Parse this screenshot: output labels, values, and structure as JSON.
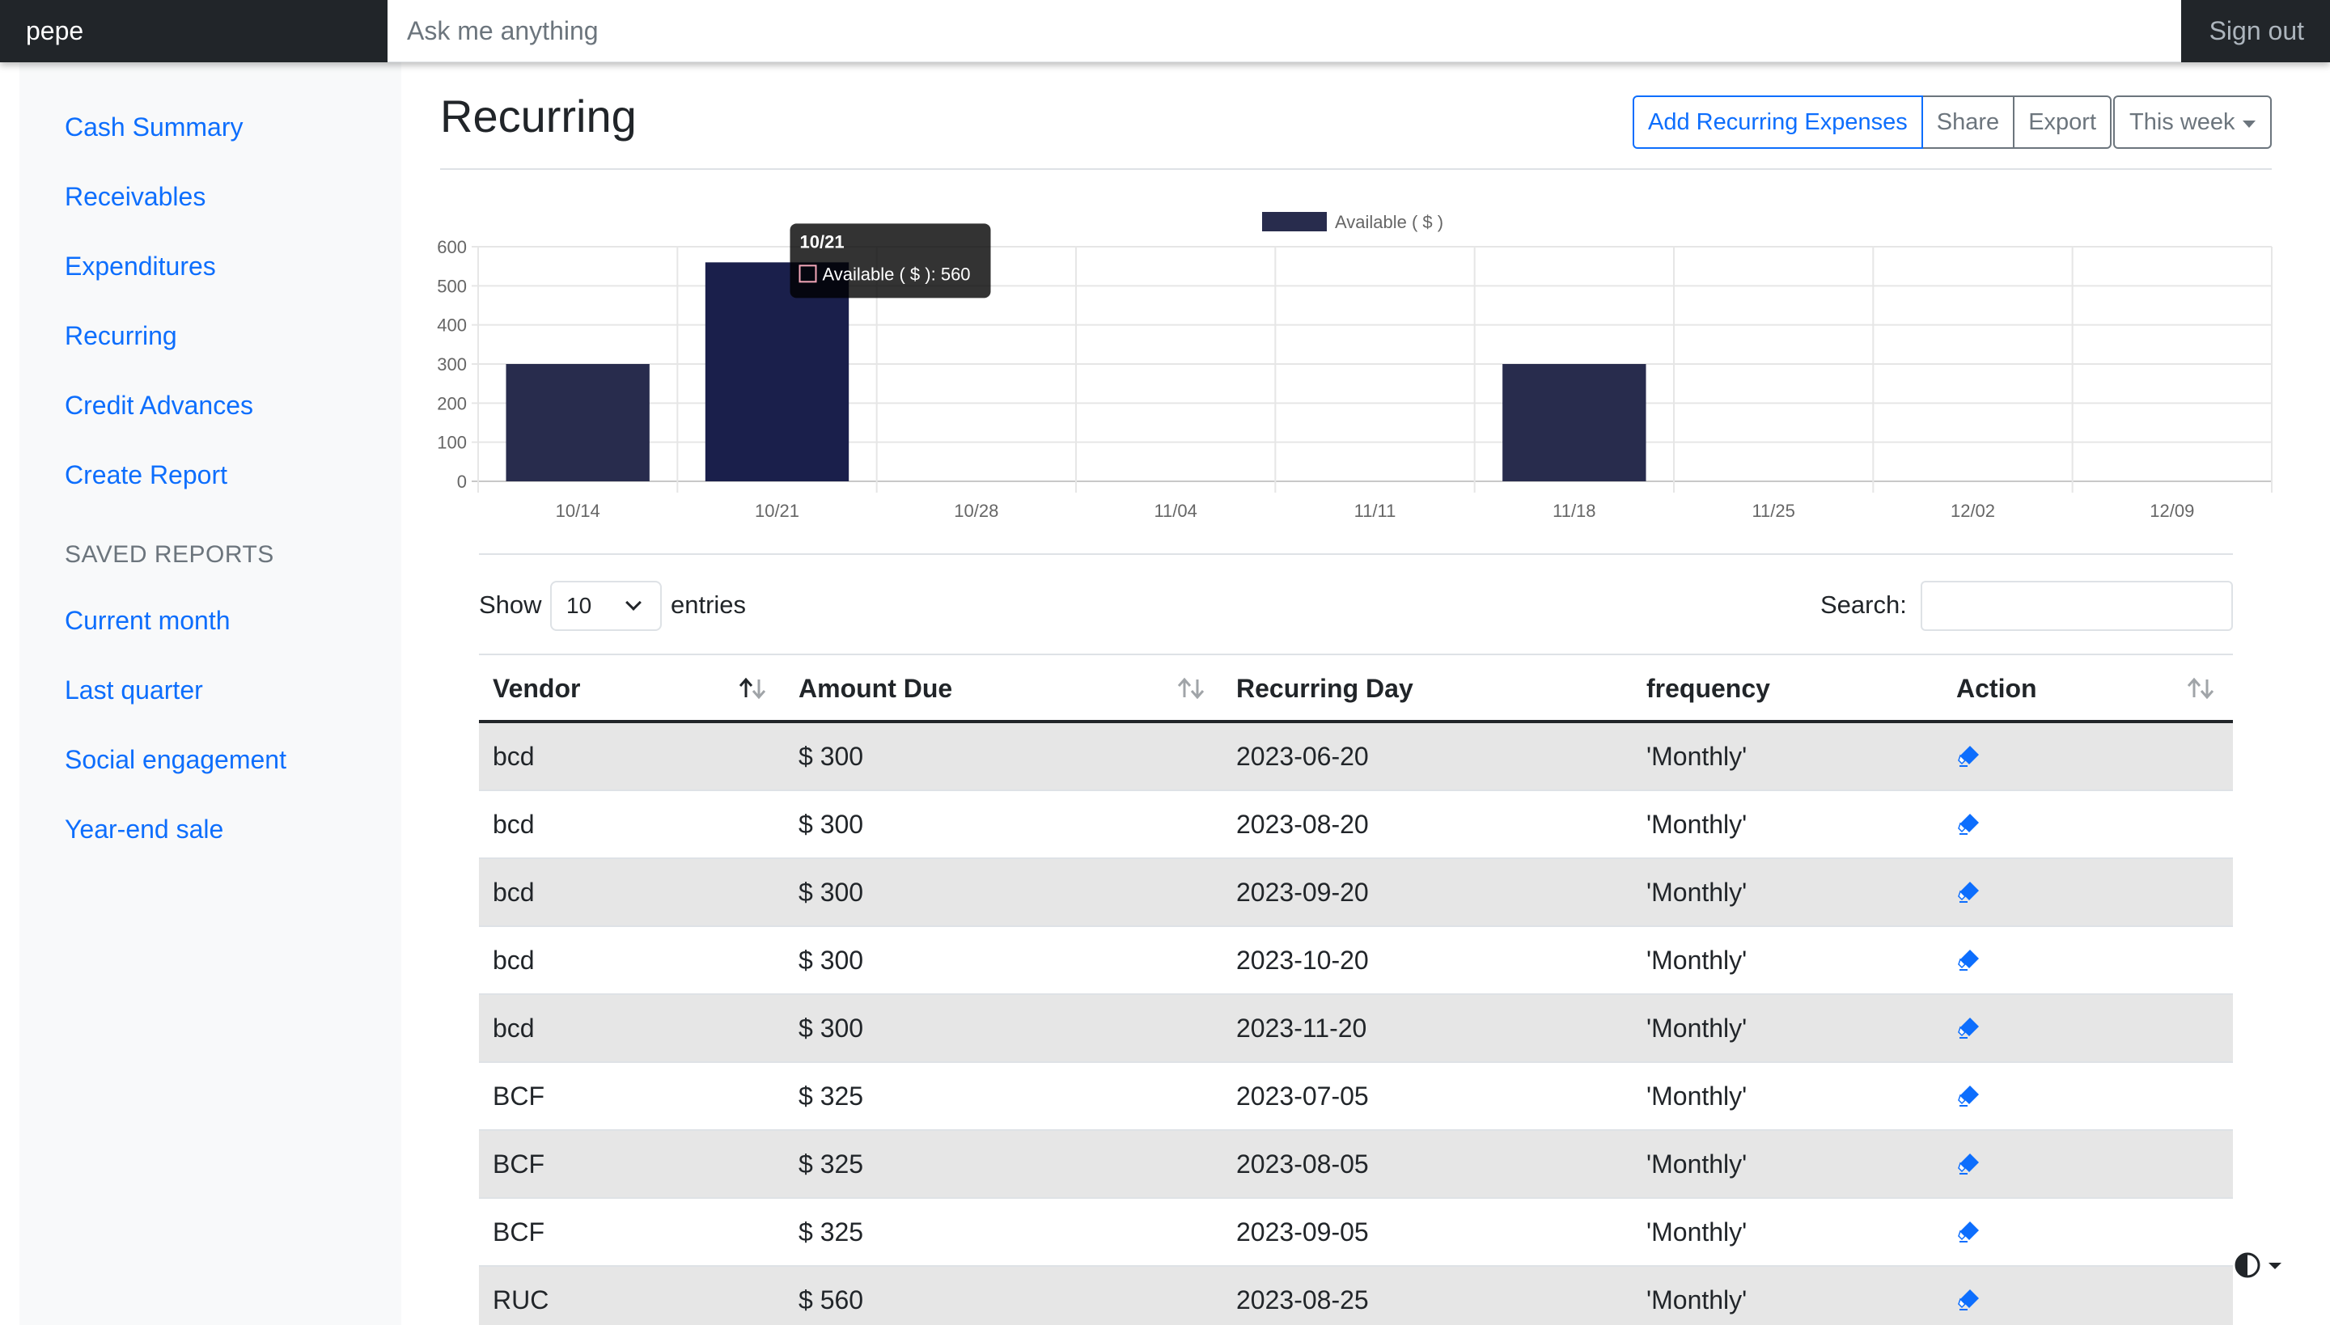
{
  "navbar": {
    "brand": "pepe",
    "search_placeholder": "Ask me anything",
    "signout_label": "Sign out"
  },
  "sidebar": {
    "items": [
      {
        "label": "Cash Summary"
      },
      {
        "label": "Receivables"
      },
      {
        "label": "Expenditures"
      },
      {
        "label": "Recurring"
      },
      {
        "label": "Credit Advances"
      },
      {
        "label": "Create Report"
      }
    ],
    "saved_heading": "Saved reports",
    "saved": [
      {
        "label": "Current month"
      },
      {
        "label": "Last quarter"
      },
      {
        "label": "Social engagement"
      },
      {
        "label": "Year-end sale"
      }
    ]
  },
  "main": {
    "title": "Recurring",
    "add_label": "Add Recurring Expenses",
    "share_label": "Share",
    "export_label": "Export",
    "range_label": "This week"
  },
  "chart_data": {
    "type": "bar",
    "categories": [
      "10/14",
      "10/21",
      "10/28",
      "11/04",
      "11/11",
      "11/18",
      "11/25",
      "12/02",
      "12/09"
    ],
    "series": [
      {
        "name": "Available ( $ )",
        "values": [
          300,
          560,
          0,
          0,
          0,
          300,
          0,
          0,
          0
        ]
      }
    ],
    "ylim": [
      0,
      600
    ],
    "yticks": [
      0,
      100,
      200,
      300,
      400,
      500,
      600
    ],
    "grid": true,
    "legend_position": "top",
    "bar_color": "#282c4d",
    "highlight_color": "#1a1f4b",
    "tooltip": {
      "category": "10/21",
      "series_index": 0,
      "title": "10/21",
      "text": "Available ( $ ): 560"
    }
  },
  "table": {
    "show_label": "Show",
    "length_value": "10",
    "entries_label": "entries",
    "search_label": "Search:",
    "columns": [
      "Vendor",
      "Amount Due",
      "Recurring Day",
      "frequency",
      "Action"
    ],
    "rows": [
      {
        "vendor": "bcd",
        "amount": "$ 300",
        "day": "2023-06-20",
        "frequency": "'Monthly'"
      },
      {
        "vendor": "bcd",
        "amount": "$ 300",
        "day": "2023-08-20",
        "frequency": "'Monthly'"
      },
      {
        "vendor": "bcd",
        "amount": "$ 300",
        "day": "2023-09-20",
        "frequency": "'Monthly'"
      },
      {
        "vendor": "bcd",
        "amount": "$ 300",
        "day": "2023-10-20",
        "frequency": "'Monthly'"
      },
      {
        "vendor": "bcd",
        "amount": "$ 300",
        "day": "2023-11-20",
        "frequency": "'Monthly'"
      },
      {
        "vendor": "BCF",
        "amount": "$ 325",
        "day": "2023-07-05",
        "frequency": "'Monthly'"
      },
      {
        "vendor": "BCF",
        "amount": "$ 325",
        "day": "2023-08-05",
        "frequency": "'Monthly'"
      },
      {
        "vendor": "BCF",
        "amount": "$ 325",
        "day": "2023-09-05",
        "frequency": "'Monthly'"
      },
      {
        "vendor": "RUC",
        "amount": "$ 560",
        "day": "2023-08-25",
        "frequency": "'Monthly'"
      }
    ],
    "action_icon": "eraser-icon",
    "accent_color": "#0d6efd"
  }
}
